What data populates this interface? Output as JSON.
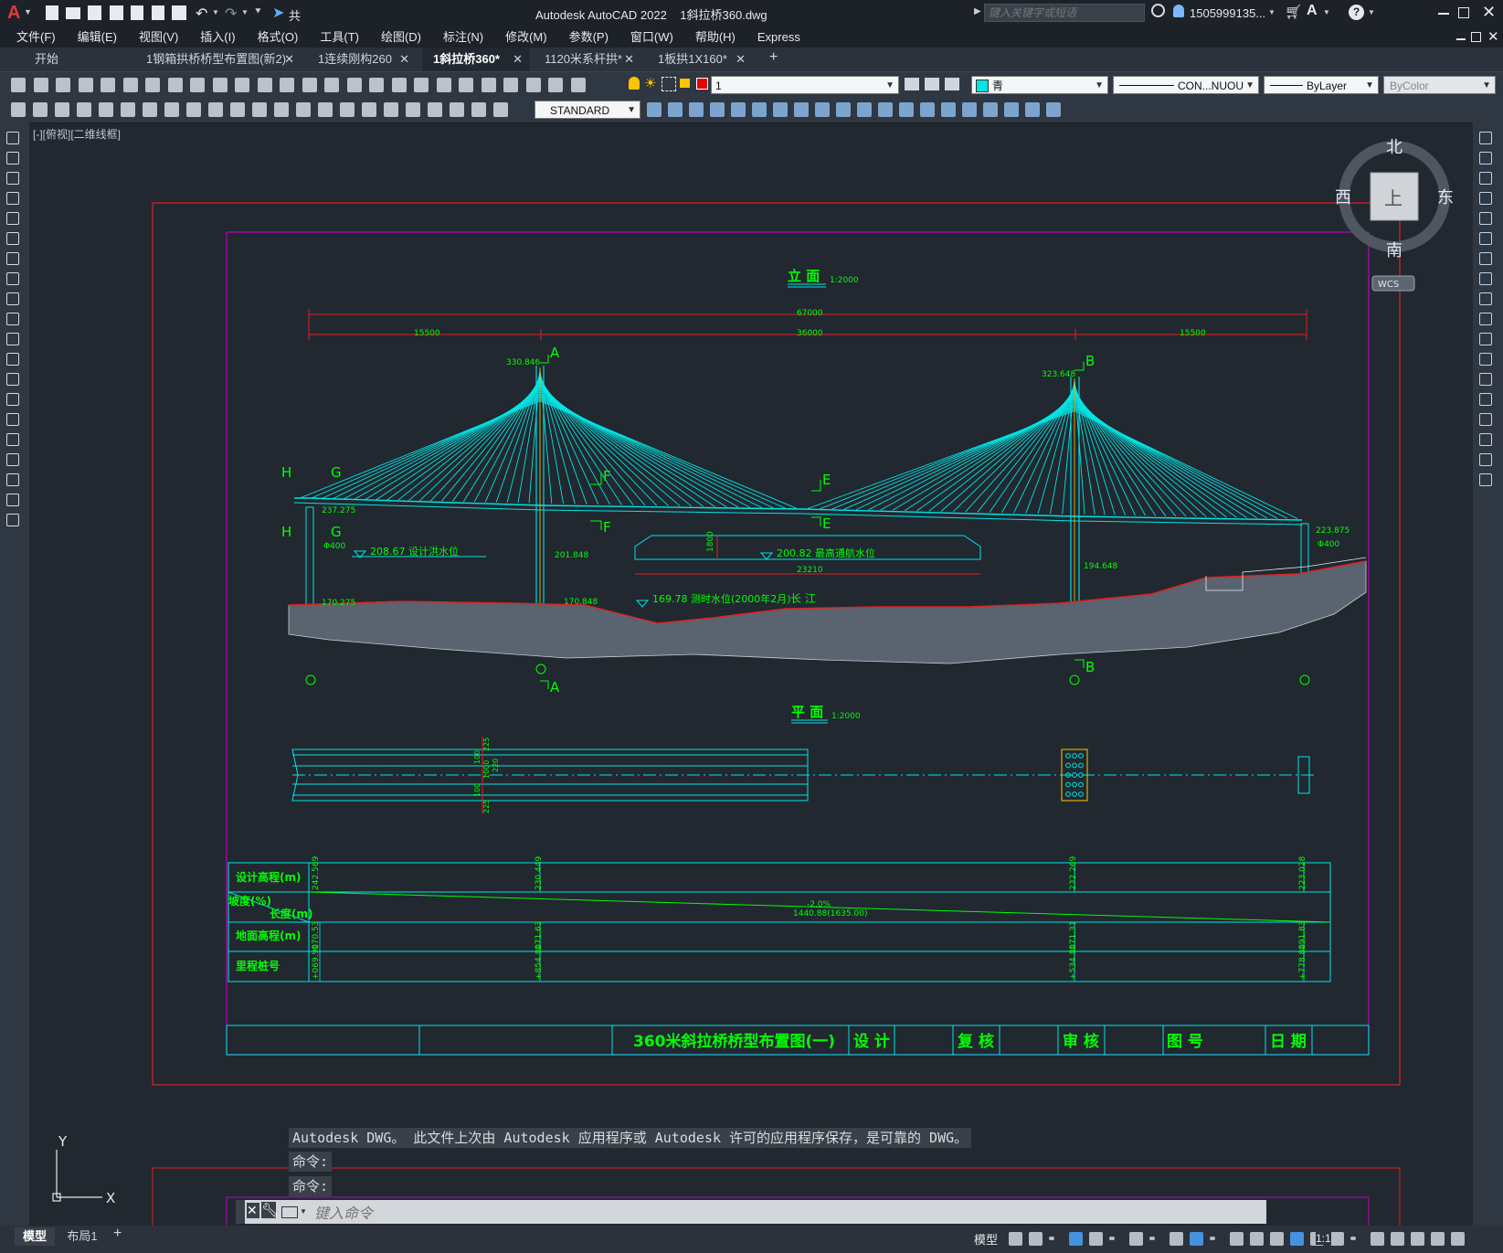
{
  "app": {
    "title": "Autodesk AutoCAD 2022",
    "file": "1斜拉桥360.dwg",
    "share_label": "共享",
    "search_placeholder": "键入关键字或短语",
    "user": "1505999135...",
    "logo_letter": "A"
  },
  "menu": [
    "文件(F)",
    "编辑(E)",
    "视图(V)",
    "插入(I)",
    "格式(O)",
    "工具(T)",
    "绘图(D)",
    "标注(N)",
    "修改(M)",
    "参数(P)",
    "窗口(W)",
    "帮助(H)",
    "Express"
  ],
  "tabs": [
    {
      "label": "开始",
      "closable": false,
      "active": false
    },
    {
      "label": "1钢箱拱桥桥型布置图(新2)",
      "closable": true,
      "active": false
    },
    {
      "label": "1连续刚构260",
      "closable": true,
      "active": false
    },
    {
      "label": "1斜拉桥360*",
      "closable": true,
      "active": true
    },
    {
      "label": "1120米系杆拱*",
      "closable": true,
      "active": false
    },
    {
      "label": "1板拱1X160*",
      "closable": true,
      "active": false
    }
  ],
  "properties": {
    "layer": "1",
    "color": "青",
    "linetype": "CON...NUOU",
    "lineweight": "ByLayer",
    "plotstyle": "ByColor",
    "textstyle": "STANDARD",
    "layer_color": "#e60000",
    "color_swatch": "#00e5e5"
  },
  "viewport": {
    "label": "[-][俯视][二维线框]"
  },
  "viewcube": {
    "north": "北",
    "south": "南",
    "east": "东",
    "west": "西",
    "face": "上",
    "wcs": "WCS"
  },
  "ucs": {
    "x": "X",
    "y": "Y"
  },
  "drawing": {
    "elevation_title": "立 面",
    "elevation_scale": "1:2000",
    "plan_title": "平 面",
    "plan_scale": "1:2000",
    "dims": {
      "total": "67000",
      "left": "15500",
      "center": "36000",
      "right": "15500",
      "sub": "23210",
      "h": "1800"
    },
    "section_marks": [
      "A",
      "B",
      "E",
      "F",
      "G",
      "H"
    ],
    "elevations": {
      "towerA_top": "330.846",
      "towerB_top": "323.648",
      "left_deck": "237.275",
      "right_deck": "223.875",
      "towerA_base": "201.848",
      "towerB_base": "194.648",
      "left_pier": "170.275",
      "towerA_foot": "170.848",
      "d400_left": "Φ400",
      "d400_right": "Φ400"
    },
    "water_levels": {
      "design_flood": "208.67 设计洪水位",
      "navigation": "200.82 最高通航水位",
      "measured": "169.78 测时水位(2000年2月)",
      "river": "长 江"
    },
    "plan_dims": [
      "225",
      "100",
      "1000",
      "220",
      "100",
      "225"
    ],
    "profile_rows": {
      "design": "设计高程(m)",
      "slope": "坡度(%)",
      "length": "长度(m)",
      "ground": "地面高程(m)",
      "station": "里程桩号"
    },
    "profile_values": {
      "slope_val": "-2.0%",
      "length_val": "1440.88(1635.00)",
      "design_vals": [
        "242.569",
        "230.449",
        "232.269",
        "223.028"
      ],
      "ground_vals": [
        "170.53",
        "171.63",
        "171.31",
        "191.83"
      ],
      "station_vals": [
        "+069.90",
        "+854.80",
        "+534.80",
        "+778.80"
      ]
    },
    "title_block": {
      "title": "360米斜拉桥桥型布置图(一)",
      "design": "设 计",
      "review": "复 核",
      "audit": "审 核",
      "drawing_no": "图 号",
      "date": "日 期"
    }
  },
  "command": {
    "history": [
      "Autodesk DWG。  此文件上次由 Autodesk 应用程序或 Autodesk 许可的应用程序保存，是可靠的 DWG。",
      "命令:",
      "命令:"
    ],
    "placeholder": "键入命令"
  },
  "layout_tabs": [
    "模型",
    "布局1"
  ],
  "status": {
    "model": "模型",
    "scale": "1:1"
  }
}
